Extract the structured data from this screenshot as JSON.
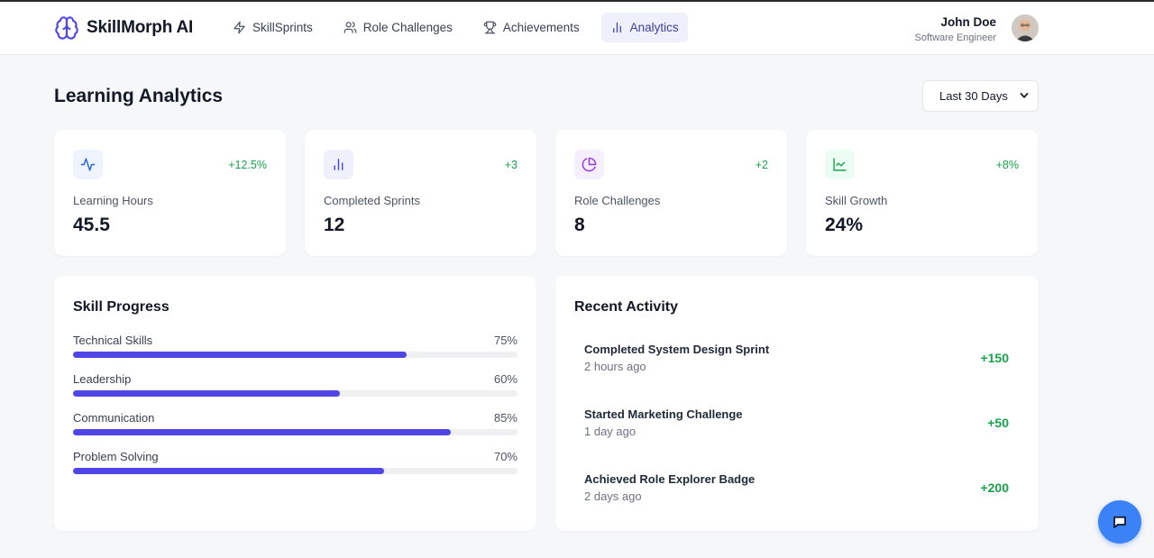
{
  "brand": {
    "name": "SkillMorph AI"
  },
  "nav": [
    {
      "label": "SkillSprints",
      "icon": "lightning-icon",
      "active": false
    },
    {
      "label": "Role Challenges",
      "icon": "users-icon",
      "active": false
    },
    {
      "label": "Achievements",
      "icon": "trophy-icon",
      "active": false
    },
    {
      "label": "Analytics",
      "icon": "bar-chart-icon",
      "active": true
    }
  ],
  "user": {
    "name": "John Doe",
    "role": "Software Engineer"
  },
  "page": {
    "title": "Learning Analytics"
  },
  "range": {
    "selected": "Last 30 Days"
  },
  "stats": [
    {
      "label": "Learning Hours",
      "value": "45.5",
      "change": "+12.5%",
      "icon": "activity-icon",
      "icon_color": "#2563eb",
      "icon_bg": "#eef3ff"
    },
    {
      "label": "Completed Sprints",
      "value": "12",
      "change": "+3",
      "icon": "bar-chart-icon",
      "icon_color": "#4f46e5",
      "icon_bg": "#eef0fb"
    },
    {
      "label": "Role Challenges",
      "value": "8",
      "change": "+2",
      "icon": "pie-chart-icon",
      "icon_color": "#9333ea",
      "icon_bg": "#f6efff"
    },
    {
      "label": "Skill Growth",
      "value": "24%",
      "change": "+8%",
      "icon": "line-chart-icon",
      "icon_color": "#16a34a",
      "icon_bg": "#ecfdf3"
    }
  ],
  "skills": {
    "title": "Skill Progress",
    "items": [
      {
        "label": "Technical Skills",
        "pct_label": "75%",
        "value": 0.75
      },
      {
        "label": "Leadership",
        "pct_label": "60%",
        "value": 0.6
      },
      {
        "label": "Communication",
        "pct_label": "85%",
        "value": 0.85
      },
      {
        "label": "Problem Solving",
        "pct_label": "70%",
        "value": 0.7
      }
    ]
  },
  "activity": {
    "title": "Recent Activity",
    "items": [
      {
        "title": "Completed System Design Sprint",
        "time": "2 hours ago",
        "points": "+150"
      },
      {
        "title": "Started Marketing Challenge",
        "time": "1 day ago",
        "points": "+50"
      },
      {
        "title": "Achieved Role Explorer Badge",
        "time": "2 days ago",
        "points": "+200"
      }
    ]
  },
  "colors": {
    "accent": "#4f46e5",
    "positive": "#16a34a",
    "chat": "#3b82f6"
  }
}
